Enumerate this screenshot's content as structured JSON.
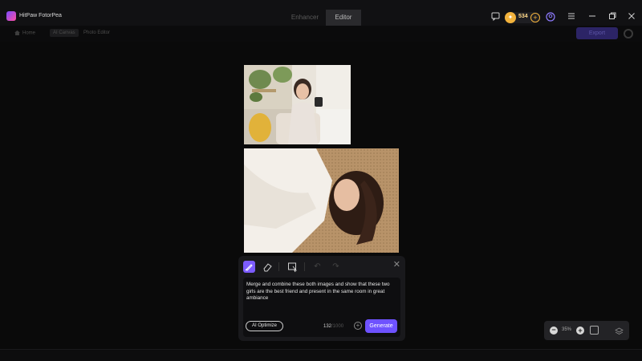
{
  "window": {
    "title": "HitPaw FotorPea"
  },
  "mode_tabs": [
    {
      "label": "Enhancer",
      "active": false
    },
    {
      "label": "Editor",
      "active": true
    }
  ],
  "titlebar": {
    "credits": "534",
    "icons": [
      "feedback-icon",
      "coin-icon",
      "add-credits-icon",
      "account-icon",
      "menu-icon",
      "minimize-icon",
      "restore-icon",
      "close-icon"
    ]
  },
  "breadcrumb": {
    "home": "Home",
    "ai_canvas": "AI Canvas",
    "photo_editor": "Photo Editor"
  },
  "toolbar": {
    "export_label": "Export"
  },
  "prompt_panel": {
    "tools": [
      "brush-icon",
      "eraser-icon",
      "select-icon",
      "undo-icon",
      "redo-icon"
    ],
    "prompt_text": "Merge and combine these both images and show that these two girls are the best friend and present in the same room in great ambiance",
    "ai_optimize_label": "AI Optimize",
    "char_count": "132",
    "char_max": "/1000",
    "generate_label": "Generate"
  },
  "zoom": {
    "level": "35%"
  },
  "colors": {
    "accent": "#6e52ff",
    "credit_gold": "#f2b23c",
    "background": "#0a0a0a"
  }
}
